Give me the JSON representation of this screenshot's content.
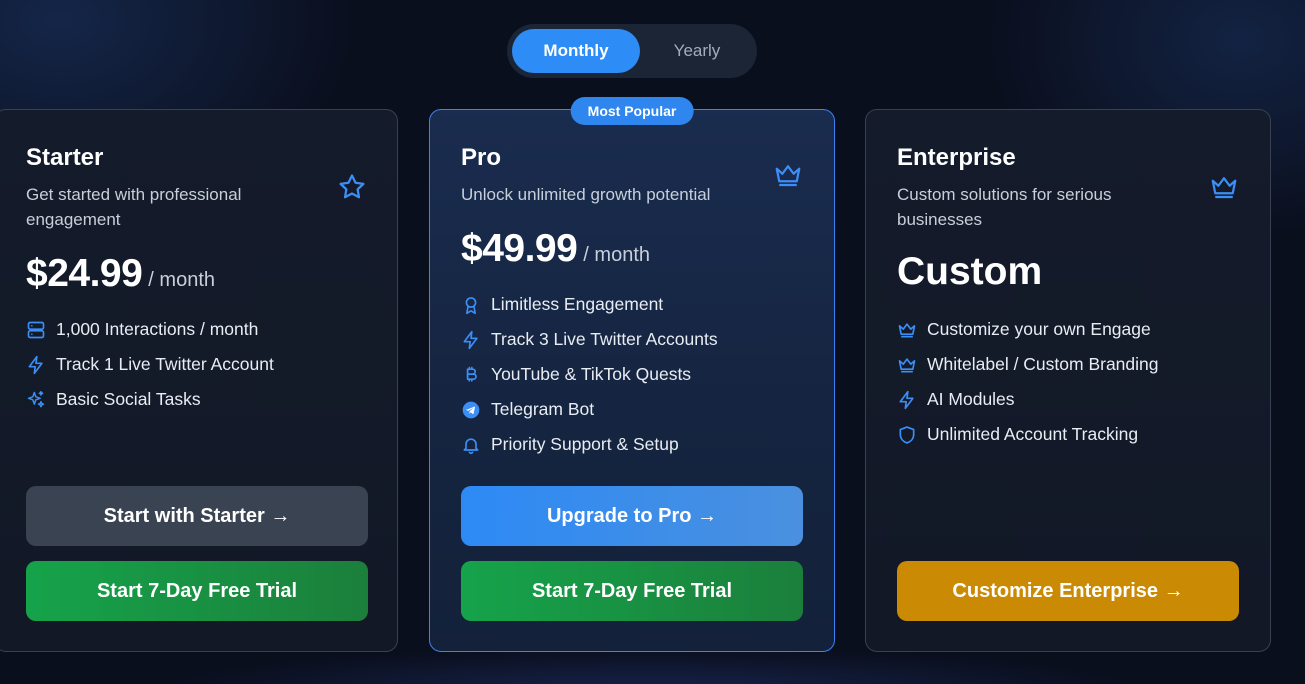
{
  "billing_toggle": {
    "monthly_label": "Monthly",
    "yearly_label": "Yearly",
    "selected": "Monthly"
  },
  "colors": {
    "accent_blue": "#2d8cf5",
    "green": "#16a34a",
    "gold": "#ca8a04",
    "background": "#0a0f1e"
  },
  "plans": {
    "starter": {
      "name": "Starter",
      "description": "Get started with professional engagement",
      "icon": "star-icon",
      "price": "$24.99",
      "period": "/ month",
      "features": [
        {
          "icon": "server-icon",
          "label": "1,000 Interactions / month"
        },
        {
          "icon": "lightning-icon",
          "label": "Track 1 Live Twitter Account"
        },
        {
          "icon": "sparkles-icon",
          "label": "Basic Social Tasks"
        }
      ],
      "primary_button": "Start with Starter →",
      "trial_button": "Start 7-Day Free Trial"
    },
    "pro": {
      "badge": "Most Popular",
      "name": "Pro",
      "description": "Unlock unlimited growth potential",
      "icon": "crown-icon",
      "price": "$49.99",
      "period": "/ month",
      "features": [
        {
          "icon": "award-icon",
          "label": "Limitless Engagement"
        },
        {
          "icon": "lightning-icon",
          "label": "Track 3 Live Twitter Accounts"
        },
        {
          "icon": "bitcoin-icon",
          "label": "YouTube & TikTok Quests"
        },
        {
          "icon": "telegram-icon",
          "label": "Telegram Bot"
        },
        {
          "icon": "bell-icon",
          "label": "Priority Support & Setup"
        }
      ],
      "primary_button": "Upgrade to Pro →",
      "trial_button": "Start 7-Day Free Trial"
    },
    "enterprise": {
      "name": "Enterprise",
      "description": "Custom solutions for serious businesses",
      "icon": "crown-icon",
      "price": "Custom",
      "features": [
        {
          "icon": "crown-icon",
          "label": "Customize your own Engage"
        },
        {
          "icon": "crown-icon",
          "label": "Whitelabel / Custom Branding"
        },
        {
          "icon": "lightning-icon",
          "label": "AI Modules"
        },
        {
          "icon": "shield-icon",
          "label": "Unlimited Account Tracking"
        }
      ],
      "primary_button": "Customize Enterprise →"
    }
  }
}
